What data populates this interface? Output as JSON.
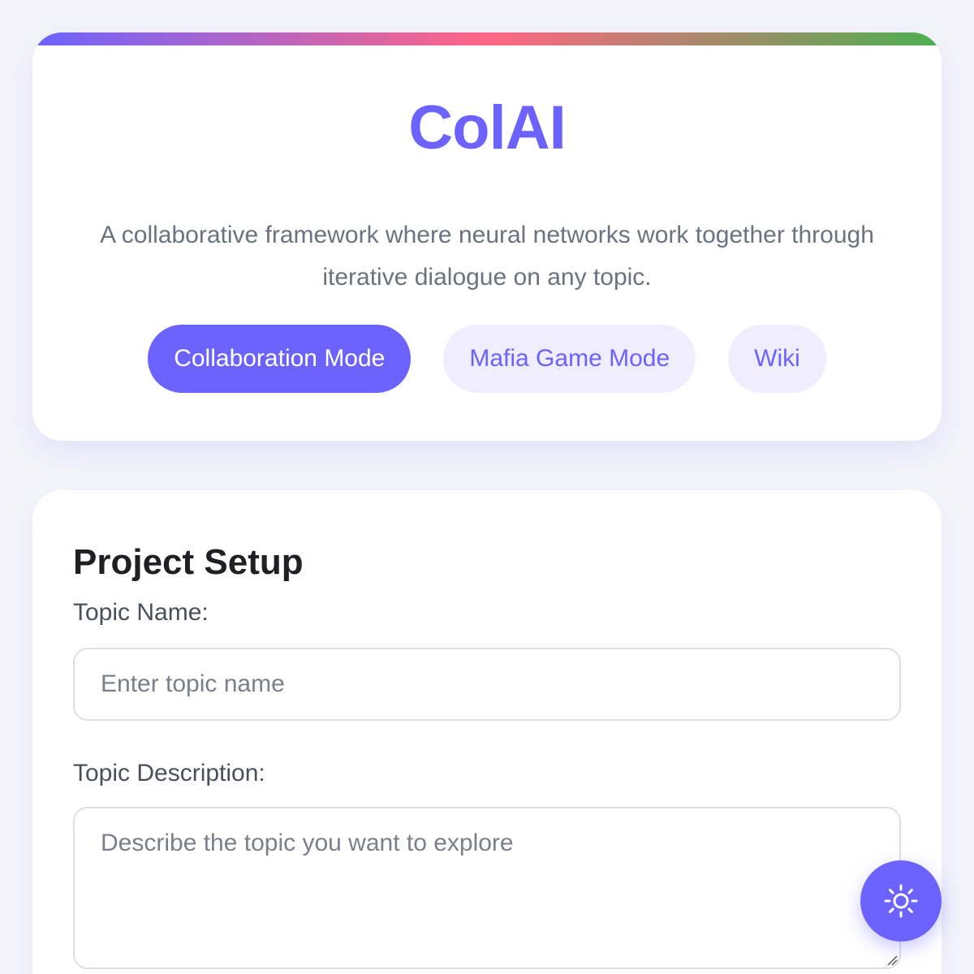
{
  "header": {
    "title": "ColAI",
    "tagline": "A collaborative framework where neural networks work together through iterative dialogue on any topic.",
    "nav": [
      {
        "label": "Collaboration Mode",
        "active": true
      },
      {
        "label": "Mafia Game Mode",
        "active": false
      },
      {
        "label": "Wiki",
        "active": false
      }
    ]
  },
  "setup": {
    "title": "Project Setup",
    "topic_name": {
      "label": "Topic Name:",
      "value": "",
      "placeholder": "Enter topic name"
    },
    "topic_description": {
      "label": "Topic Description:",
      "value": "",
      "placeholder": "Describe the topic you want to explore"
    }
  },
  "theme_toggle": {
    "icon": "sun-icon"
  },
  "colors": {
    "accent": "#6c63ff",
    "accent_light": "#efedff",
    "gradient": [
      "#6c63ff",
      "#ff6584",
      "#4caf50"
    ],
    "background": "#f4f4fa",
    "muted_text": "#6b7280",
    "heading_text": "#1f2023"
  }
}
